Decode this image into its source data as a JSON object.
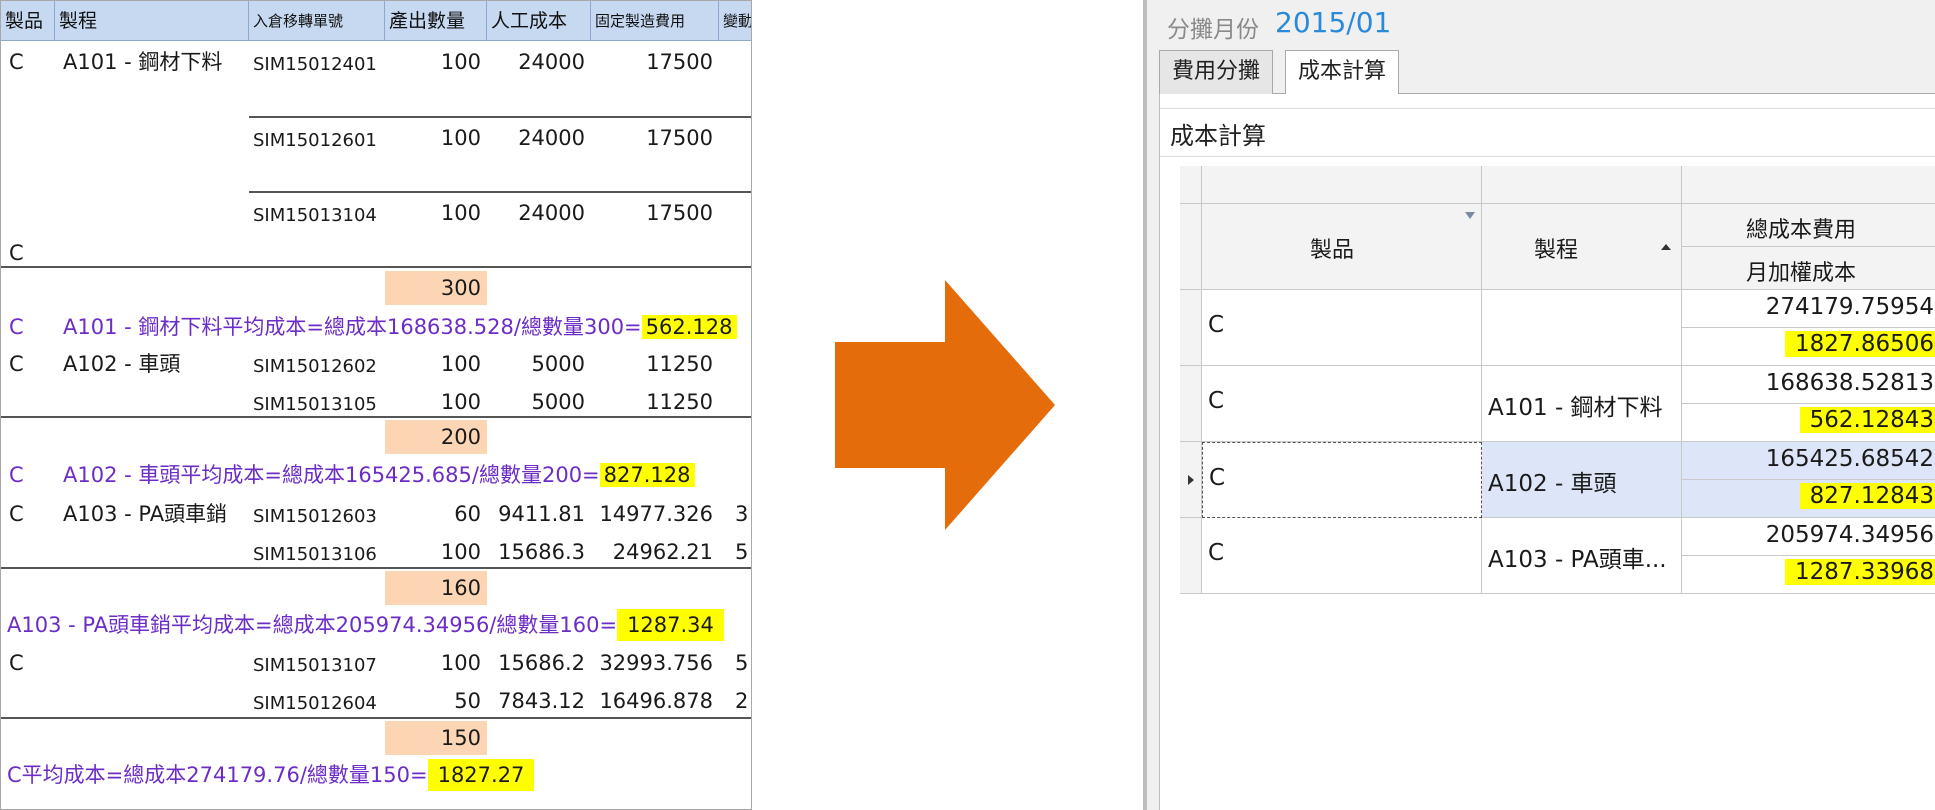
{
  "sheet": {
    "headers": [
      "製品",
      "製程",
      "入倉移轉單號",
      "產出數量",
      "人工成本",
      "固定製造費用",
      "變動"
    ],
    "rows": [
      {
        "product": "C",
        "process": "A101 - 鋼材下料",
        "doc": "SIM15012401",
        "qty": "100",
        "labor": "24000",
        "fixed": "17500",
        "var": ""
      },
      {
        "product": "",
        "process": "",
        "doc": "SIM15012601",
        "qty": "100",
        "labor": "24000",
        "fixed": "17500",
        "var": ""
      },
      {
        "product": "",
        "process": "",
        "doc": "SIM15013104",
        "qty": "100",
        "labor": "24000",
        "fixed": "17500",
        "var": ""
      },
      {
        "product": "C",
        "process": "",
        "doc": "",
        "qty": "",
        "labor": "",
        "fixed": "",
        "var": ""
      },
      {
        "product": "C",
        "process": "A102 - 車頭",
        "doc": "SIM15012602",
        "qty": "100",
        "labor": "5000",
        "fixed": "11250",
        "var": ""
      },
      {
        "product": "",
        "process": "",
        "doc": "SIM15013105",
        "qty": "100",
        "labor": "5000",
        "fixed": "11250",
        "var": ""
      },
      {
        "product": "C",
        "process": "A103 - PA頭車銷",
        "doc": "SIM15012603",
        "qty": "60",
        "labor": "9411.81",
        "fixed": "14977.326",
        "var": "3"
      },
      {
        "product": "",
        "process": "",
        "doc": "SIM15013106",
        "qty": "100",
        "labor": "15686.3",
        "fixed": "24962.21",
        "var": "5"
      },
      {
        "product": "C",
        "process": "",
        "doc": "SIM15013107",
        "qty": "100",
        "labor": "15686.2",
        "fixed": "32993.756",
        "var": "5"
      },
      {
        "product": "",
        "process": "",
        "doc": "SIM15012604",
        "qty": "50",
        "labor": "7843.12",
        "fixed": "16496.878",
        "var": "2"
      }
    ],
    "subtotals": [
      "300",
      "200",
      "160",
      "150"
    ],
    "summaries": [
      {
        "c": "C",
        "text": "A101 - 鋼材下料平均成本=總成本168638.528/總數量300=",
        "value": "562.128"
      },
      {
        "c": "C",
        "text": "A102 - 車頭平均成本=總成本165425.685/總數量200=",
        "value": "827.128"
      },
      {
        "c": "",
        "text": "A103 - PA頭車銷平均成本=總成本205974.34956/總數量160=",
        "value": "1287.34"
      },
      {
        "c": "",
        "text": "C平均成本=總成本274179.76/總數量150=",
        "value": "1827.27"
      }
    ]
  },
  "arrow": {
    "color": "#e46c0a",
    "icon": "right-arrow-icon"
  },
  "app": {
    "month_label": "分攤月份",
    "month_value": "2015/01",
    "tabs": [
      "費用分攤",
      "成本計算"
    ],
    "active_tab": 1,
    "panel_title": "成本計算",
    "grid": {
      "col_product": "製品",
      "col_process": "製程",
      "col_total": "總成本費用",
      "col_weighted": "月加權成本",
      "rows": [
        {
          "product": "C",
          "process": "",
          "total": "274179.75954",
          "weighted": "1827.86506"
        },
        {
          "product": "C",
          "process": "A101 - 鋼材下料",
          "total": "168638.52813",
          "weighted": "562.12843"
        },
        {
          "product": "C",
          "process": "A102 - 車頭",
          "total": "165425.68542",
          "weighted": "827.12843"
        },
        {
          "product": "C",
          "process": "A103 - PA頭車...",
          "total": "205974.34956",
          "weighted": "1287.33968"
        }
      ]
    }
  }
}
